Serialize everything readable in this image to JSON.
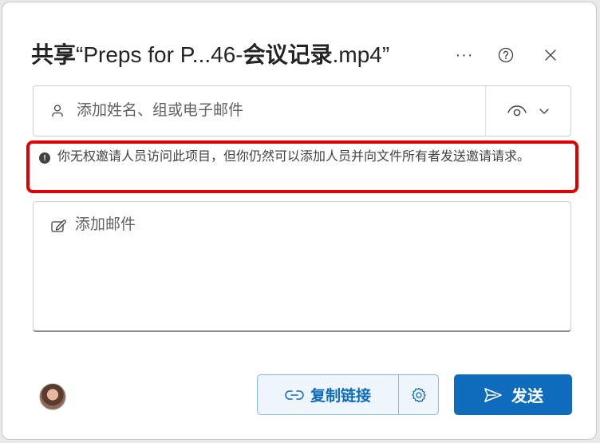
{
  "dialog": {
    "title_part1": "共享",
    "title_part2": "“Preps for P...46-",
    "title_part3": "会议记录",
    "title_part4": ".mp4”",
    "more_label": "···"
  },
  "recipients": {
    "placeholder": "添加姓名、组或电子邮件",
    "value": ""
  },
  "notice": {
    "icon_glyph": "!",
    "text": "你无权邀请人员访问此项目，但你仍然可以添加人员并向文件所有者发送邀请请求。"
  },
  "message": {
    "placeholder": "添加邮件",
    "value": ""
  },
  "footer": {
    "copy_link_label": "复制链接",
    "send_label": "发送"
  },
  "colors": {
    "accent": "#0f6cbd",
    "highlight_border": "#e00000"
  },
  "icons": {
    "more": "more-icon",
    "help": "help-icon",
    "close": "close-icon",
    "person": "person-icon",
    "view": "eye-icon",
    "chevron": "chevron-down-icon",
    "info": "info-icon",
    "compose": "compose-icon",
    "link": "link-icon",
    "settings": "gear-icon",
    "send": "send-icon"
  }
}
